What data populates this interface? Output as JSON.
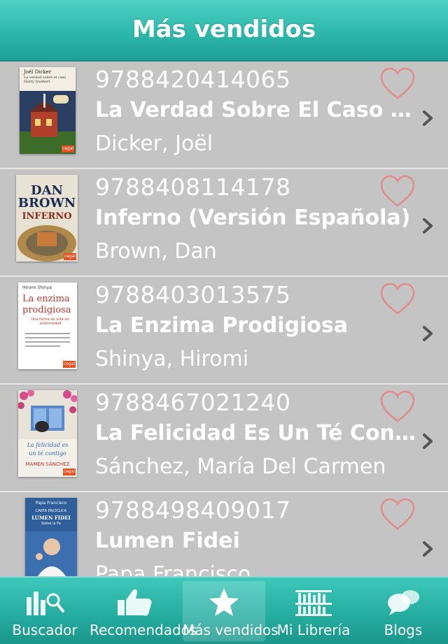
{
  "header": {
    "title": "Más vendidos"
  },
  "books": [
    {
      "isbn": "9788420414065",
      "title": "La Verdad Sobre El Caso Harry Quebert",
      "author": "Dicker, Joël",
      "cover_name": "cover-verdad-harry-quebert",
      "cover_text": [
        "Joël Dicker",
        "La verdad sobre el caso Harry Quebert"
      ]
    },
    {
      "isbn": "9788408114178",
      "title": "Inferno (Versión Española)",
      "author": "Brown, Dan",
      "cover_name": "cover-inferno",
      "cover_text": [
        "DAN",
        "BROWN",
        "INFERNO"
      ]
    },
    {
      "isbn": "9788403013575",
      "title": "La Enzima Prodigiosa",
      "author": "Shinya, Hiromi",
      "cover_name": "cover-enzima-prodigiosa",
      "cover_text": [
        "Hiromi Shinya",
        "La enzima",
        "prodigiosa",
        "Una forma de vida sin enfermedad"
      ]
    },
    {
      "isbn": "9788467021240",
      "title": "La Felicidad Es Un Té Contigo",
      "author": "Sánchez, María Del Carmen",
      "cover_name": "cover-felicidad-te-contigo",
      "cover_text": [
        "La felicidad es",
        "un té contigo",
        "MAMEN SÁNCHEZ"
      ]
    },
    {
      "isbn": "9788498409017",
      "title": "Lumen Fidei",
      "author": "Papa Francisco",
      "cover_name": "cover-lumen-fidei",
      "cover_text": [
        "Papa Francisco",
        "CARTA ENCÍCLICA",
        "LUMEN FIDEI",
        "Sobre la Fe"
      ]
    }
  ],
  "cover_badge": "cegal",
  "tabs": [
    {
      "label": "Buscador",
      "icon": "search-chart-icon"
    },
    {
      "label": "Recomendados",
      "icon": "thumbs-up-icon"
    },
    {
      "label": "Más vendidos",
      "icon": "star-icon"
    },
    {
      "label": "Mi Librería",
      "icon": "bookshelf-icon"
    },
    {
      "label": "Blogs",
      "icon": "chat-bubbles-icon"
    }
  ],
  "colors": {
    "accent": "#2db8ab",
    "heart": "#e38a8a",
    "background": "#c4c4c4"
  }
}
